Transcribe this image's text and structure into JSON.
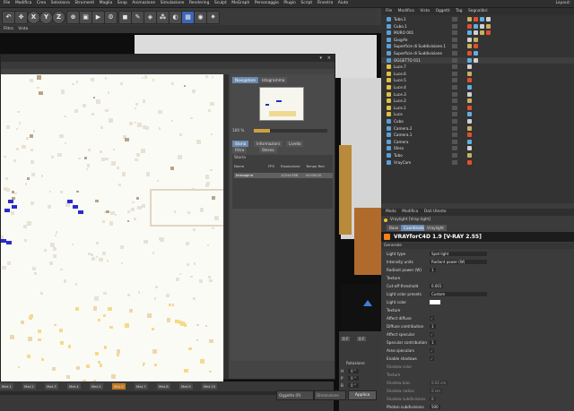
{
  "menubar": {
    "items": [
      "File",
      "Modifica",
      "Crea",
      "Seleziona",
      "Strumenti",
      "Maglia",
      "Snap",
      "Animazione",
      "Simulazione",
      "Rendering",
      "Sculpt",
      "MoGraph",
      "Personaggio",
      "Plugin",
      "Script",
      "Finestra",
      "Aiuto"
    ],
    "layout_label": "Layout:"
  },
  "toolbar": {
    "axis_x": "X",
    "axis_y": "Y",
    "axis_z": "Z"
  },
  "viewport_menu": [
    "Filtro",
    "Vista"
  ],
  "object_manager": {
    "menu": [
      "File",
      "Modifica",
      "Vista",
      "Oggetti",
      "Tag",
      "Segnalibri"
    ],
    "objects": [
      "Tubo.1",
      "Cubo.1",
      "MURO 001",
      "Giogrfe",
      "Superficie di Suddivisione.1",
      "Superficie di Suddivisione",
      "OGGETTO 011",
      "Luce.7",
      "Luce.6",
      "Luce.5",
      "Luce.4",
      "Luce.3",
      "Luce.2",
      "Luce.1",
      "Luce",
      "Cubo",
      "Camera.2",
      "Camera.1",
      "Camera",
      "Sfera",
      "Tubo",
      "VrayCam"
    ]
  },
  "picture_viewer": {
    "tabs": [
      "Navigatore",
      "Istogramma"
    ],
    "zoom": "100 %",
    "subtabs": [
      "Storia",
      "Informazioni",
      "Livello",
      "Filtro",
      "Stereo"
    ],
    "history_title": "Storia",
    "history_headers": [
      "Nome",
      "FPS",
      "Risoluzione",
      "Tempo Ren"
    ],
    "history_row": [
      "Immagine",
      "",
      "1024x768",
      "00:08:00"
    ]
  },
  "attribute_manager": {
    "menu": [
      "Modo",
      "Modifica",
      "Dati Utente"
    ],
    "object_label": "Vraylight [Vray-light]",
    "tabs": [
      "Base",
      "Coordinate",
      "Vraylight"
    ],
    "banner": "VRAYforC4D 1.9 [V-RAY 2.55]",
    "section": "Generale",
    "rows": [
      {
        "label": "Light type",
        "value": "Spot light"
      },
      {
        "label": "Intensity units",
        "value": "Radiant power (W)"
      },
      {
        "label": "Radiant power (W)",
        "value": "1"
      },
      {
        "label": "Texture",
        "value": ""
      },
      {
        "label": "Cut-off threshold",
        "value": "0.001"
      },
      {
        "label": "Light color presets",
        "value": "Custom"
      },
      {
        "label": "Light color",
        "value": ""
      },
      {
        "label": "Texture",
        "value": ""
      },
      {
        "label": "Affect diffuse",
        "value": ""
      },
      {
        "label": "Diffuse contribution",
        "value": "1"
      },
      {
        "label": "Affect specular",
        "value": ""
      },
      {
        "label": "Specular contribution",
        "value": "1"
      },
      {
        "label": "Area speculars",
        "value": ""
      },
      {
        "label": "Enable shadows",
        "value": ""
      },
      {
        "label": "Shadow color",
        "value": ""
      },
      {
        "label": "Texture",
        "value": ""
      },
      {
        "label": "Shadow bias",
        "value": "0.02 cm"
      },
      {
        "label": "Shadow radius",
        "value": "0 cm"
      },
      {
        "label": "Shadow subdivisions",
        "value": "8"
      },
      {
        "label": "Photon subdivisions",
        "value": "500"
      }
    ]
  },
  "bottom": {
    "materials": [
      "Mat.1",
      "Mat.2",
      "Mat.3",
      "Mat.4",
      "Mat.5",
      "Mat.6",
      "Mat.7",
      "Mat.8",
      "Mat.9",
      "Mat.10"
    ],
    "object_select": "Oggetto (R)",
    "size_select": "Dimensione",
    "apply": "Applica",
    "rotation": "Rotazione",
    "frame_a": "0 F",
    "frame_b": "0 F",
    "h": "H",
    "p": "P",
    "b": "B",
    "h_val": "0 °",
    "p_val": "0 °",
    "b_val": "0 °"
  },
  "colors": {
    "accent": "#6a8ab0",
    "vray_orange": "#f08020"
  }
}
